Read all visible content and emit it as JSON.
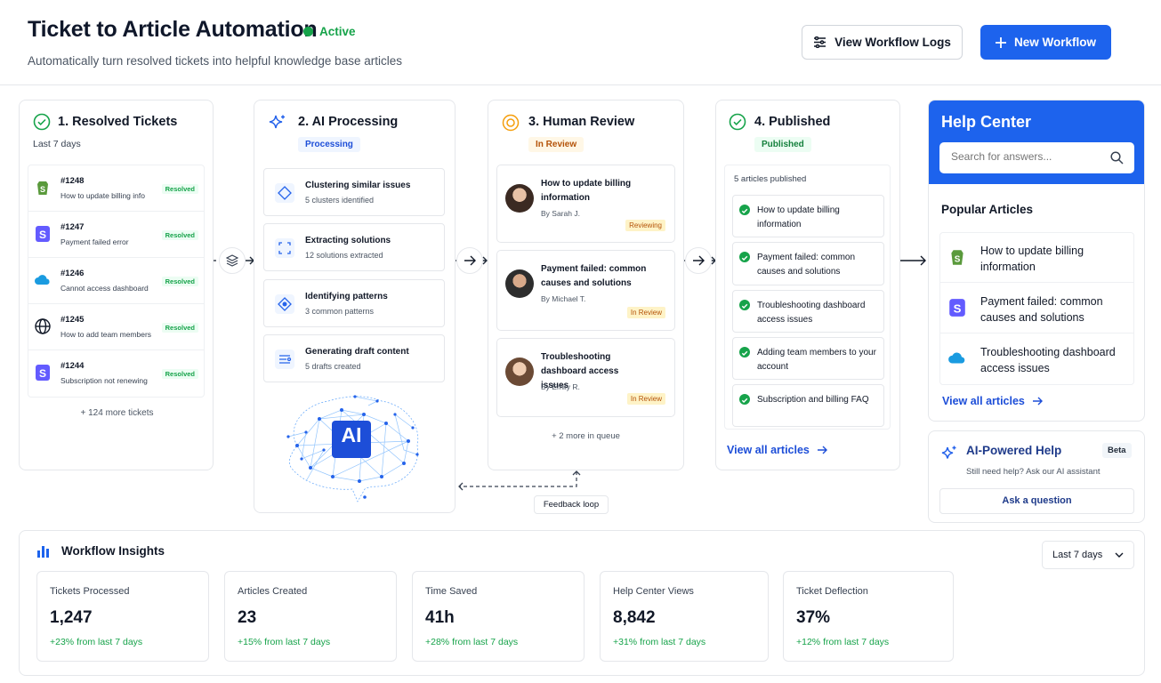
{
  "header": {
    "title": "Ticket to Article Automation",
    "status": "Active",
    "subtitle": "Automatically turn resolved tickets into helpful knowledge base articles",
    "logs_button": "View Workflow Logs",
    "new_button": "New Workflow"
  },
  "stage1": {
    "title": "1. Resolved Tickets",
    "period": "Last 7 days",
    "tickets": [
      {
        "id": "#1248",
        "title": "How to update billing info",
        "badge": "Resolved",
        "icon": "shopify-icon"
      },
      {
        "id": "#1247",
        "title": "Payment failed error",
        "badge": "Resolved",
        "icon": "stripe-icon"
      },
      {
        "id": "#1246",
        "title": "Cannot access dashboard",
        "badge": "Resolved",
        "icon": "cloud-icon"
      },
      {
        "id": "#1245",
        "title": "How to add team members",
        "badge": "Resolved",
        "icon": "globe-icon"
      },
      {
        "id": "#1244",
        "title": "Subscription not renewing",
        "badge": "Resolved",
        "icon": "stripe-icon"
      }
    ],
    "more": "+ 124 more tickets"
  },
  "stage2": {
    "title": "2. AI Processing",
    "badge": "Processing",
    "steps": [
      {
        "title": "Clustering similar issues",
        "sub": "5 clusters identified"
      },
      {
        "title": "Extracting solutions",
        "sub": "12 solutions extracted"
      },
      {
        "title": "Identifying patterns",
        "sub": "3 common patterns"
      },
      {
        "title": "Generating draft content",
        "sub": "5 drafts created"
      }
    ],
    "brain_label": "AI"
  },
  "stage3": {
    "title": "3. Human Review",
    "badge": "In Review",
    "items": [
      {
        "title": "How to update billing information",
        "by": "By Sarah J.",
        "status": "Reviewing"
      },
      {
        "title": "Payment failed: common causes and solutions",
        "by": "By Michael T.",
        "status": "In Review"
      },
      {
        "title": "Troubleshooting dashboard access issues",
        "by": "By Emily R.",
        "status": "In Review"
      }
    ],
    "more": "+ 2 more in queue",
    "feedback": "Feedback loop"
  },
  "stage4": {
    "title": "4. Published",
    "badge": "Published",
    "count": "5 articles published",
    "articles": [
      "How to update billing information",
      "Payment failed: common causes and solutions",
      "Troubleshooting dashboard access issues",
      "Adding team members to your account",
      "Subscription and billing FAQ"
    ],
    "view_all": "View all articles"
  },
  "help_center": {
    "title": "Help Center",
    "search_placeholder": "Search for answers...",
    "popular_heading": "Popular Articles",
    "articles": [
      {
        "title": "How to update billing information",
        "icon": "shopify-icon"
      },
      {
        "title": "Payment failed: common causes and solutions",
        "icon": "stripe-icon"
      },
      {
        "title": "Troubleshooting dashboard access issues",
        "icon": "cloud-icon"
      }
    ],
    "view_all": "View all articles"
  },
  "ai_help": {
    "title": "AI-Powered Help",
    "beta": "Beta",
    "sub": "Still need help? Ask our AI assistant",
    "button": "Ask a question"
  },
  "insights": {
    "title": "Workflow Insights",
    "range": "Last 7 days",
    "stats": [
      {
        "label": "Tickets Processed",
        "value": "1,247",
        "delta": "+23% from last 7 days"
      },
      {
        "label": "Articles Created",
        "value": "23",
        "delta": "+15% from last 7 days"
      },
      {
        "label": "Time Saved",
        "value": "41h",
        "delta": "+28% from last 7 days"
      },
      {
        "label": "Help Center Views",
        "value": "8,842",
        "delta": "+31% from last 7 days"
      },
      {
        "label": "Ticket Deflection",
        "value": "37%",
        "delta": "+12% from last 7 days"
      }
    ]
  },
  "colors": {
    "accent": "#1d63ed",
    "success": "#16a34a",
    "warning": "#b45309"
  }
}
